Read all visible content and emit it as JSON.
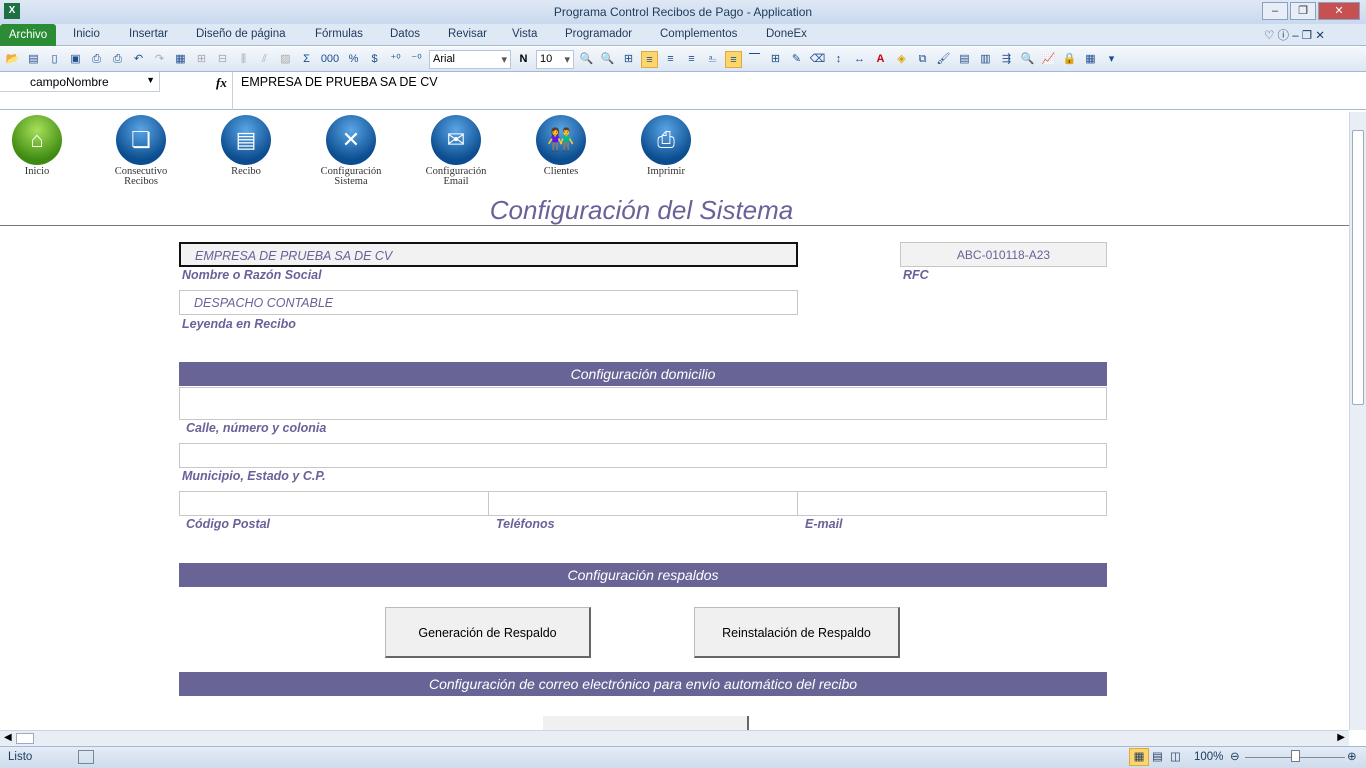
{
  "window": {
    "title": "Programa Control Recibos de Pago  -  Application"
  },
  "ribbon_tabs": [
    "Archivo",
    "Inicio",
    "Insertar",
    "Diseño de página",
    "Fórmulas",
    "Datos",
    "Revisar",
    "Vista",
    "Programador",
    "Complementos",
    "DoneEx"
  ],
  "toolbar": {
    "font": "Arial",
    "size": "10",
    "bold_label": "N",
    "sum": "Σ",
    "thousands": "000",
    "percent": "%",
    "currency": "$"
  },
  "formula_bar": {
    "name_box": "campoNombre",
    "fx": "fx",
    "content": "EMPRESA DE PRUEBA SA DE CV"
  },
  "nav": [
    {
      "label1": "Inicio",
      "label2": ""
    },
    {
      "label1": "Consecutivo",
      "label2": "Recibos"
    },
    {
      "label1": "Recibo",
      "label2": ""
    },
    {
      "label1": "Configuración",
      "label2": "Sistema"
    },
    {
      "label1": "Configuración",
      "label2": "Email"
    },
    {
      "label1": "Clientes",
      "label2": ""
    },
    {
      "label1": "Imprimir",
      "label2": ""
    }
  ],
  "page": {
    "title": "Configuración del Sistema"
  },
  "form": {
    "nombre_value": "EMPRESA DE PRUEBA SA DE CV",
    "nombre_label": "Nombre o Razón Social",
    "rfc_value": "ABC-010118-A23",
    "rfc_label": "RFC",
    "leyenda_value": "DESPACHO CONTABLE",
    "leyenda_label": "Leyenda en Recibo",
    "domicilio_header": "Configuración domicilio",
    "calle_label": "Calle, número y colonia",
    "municipio_label": "Municipio, Estado y C.P.",
    "cp_label": "Código Postal",
    "telefonos_label": "Teléfonos",
    "email_label": "E-mail",
    "respaldos_header": "Configuración respaldos",
    "gen_respaldo": "Generación  de Respaldo",
    "reinst_respaldo": "Reinstalación  de Respaldo",
    "correo_header": "Configuración de correo electrónico para envío automático del recibo"
  },
  "status": {
    "text": "Listo",
    "zoom": "100%"
  }
}
